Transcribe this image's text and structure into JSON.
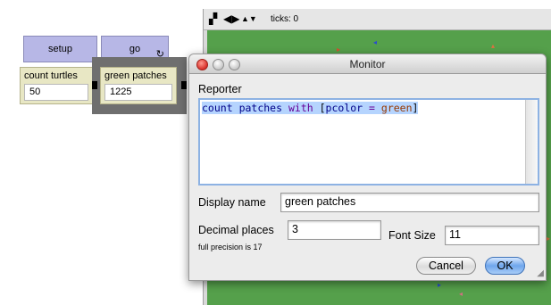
{
  "interface": {
    "buttons": [
      {
        "label": "setup"
      },
      {
        "label": "go",
        "forever_icon": "↻"
      }
    ],
    "monitors": [
      {
        "label": "count turtles",
        "value": "50"
      },
      {
        "label": "green patches",
        "value": "1225"
      }
    ]
  },
  "view": {
    "toolbar_icons": [
      "▞",
      "◀▶",
      "▲▼"
    ],
    "ticks_label": "ticks: 0",
    "colors": {
      "world": "#55a04b"
    }
  },
  "dialog": {
    "title": "Monitor",
    "reporter_label": "Reporter",
    "reporter_tokens": [
      {
        "text": "count",
        "kind": "kw"
      },
      {
        "text": " ",
        "kind": "sp"
      },
      {
        "text": "patches",
        "kind": "kw"
      },
      {
        "text": " ",
        "kind": "sp"
      },
      {
        "text": "with",
        "kind": "prim"
      },
      {
        "text": " ",
        "kind": "sp"
      },
      {
        "text": "[",
        "kind": "br"
      },
      {
        "text": "pcolor",
        "kind": "kw"
      },
      {
        "text": " ",
        "kind": "sp"
      },
      {
        "text": "=",
        "kind": "prim"
      },
      {
        "text": " ",
        "kind": "sp"
      },
      {
        "text": "green",
        "kind": "const"
      },
      {
        "text": "]",
        "kind": "br"
      }
    ],
    "display_name_label": "Display name",
    "display_name_value": "green patches",
    "decimal_places_label": "Decimal places",
    "decimal_places_value": "3",
    "precision_note": "full precision is 17",
    "font_size_label": "Font Size",
    "font_size_value": "11",
    "cancel_label": "Cancel",
    "ok_label": "OK",
    "colors": {
      "ok_button": "#6fa6ec",
      "selection": "#b5d4fe",
      "focus_ring": "#8db2e3"
    }
  }
}
